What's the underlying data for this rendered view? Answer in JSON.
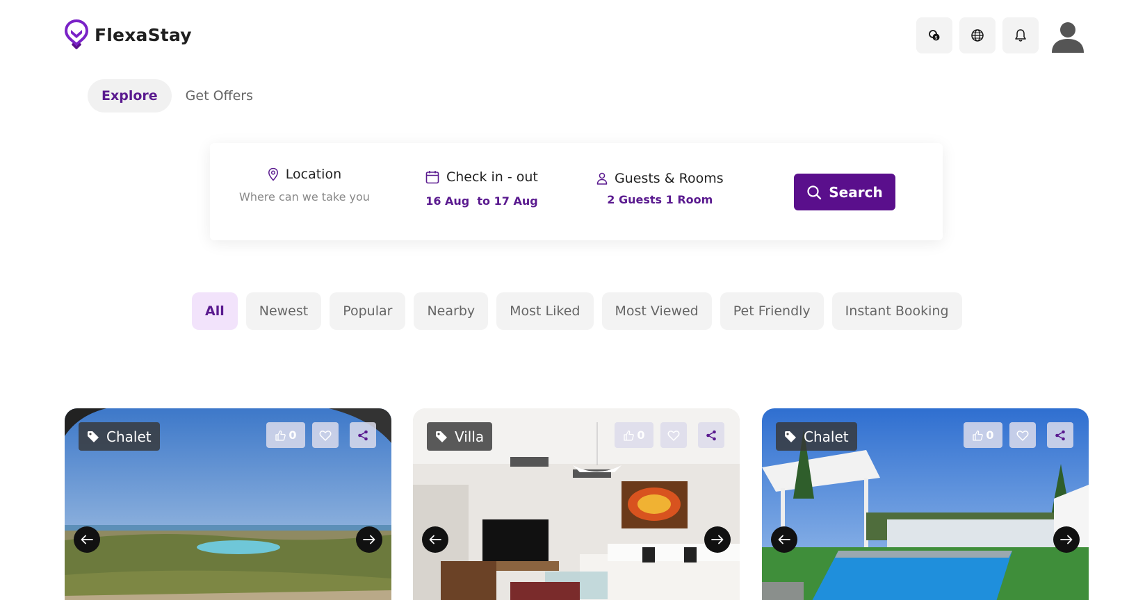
{
  "brand": {
    "name": "FlexaStay",
    "accent": "#5a0f8c"
  },
  "header": {
    "icons": [
      "currency-icon",
      "globe-icon",
      "bell-icon",
      "user-avatar"
    ]
  },
  "tabs": [
    {
      "label": "Explore",
      "active": true
    },
    {
      "label": "Get Offers",
      "active": false
    }
  ],
  "search": {
    "location": {
      "label": "Location",
      "placeholder": "Where can we take you"
    },
    "dates": {
      "label": "Check in - out",
      "value": "16 Aug  to 17 Aug"
    },
    "guests": {
      "label": "Guests & Rooms",
      "value": "2 Guests 1 Room"
    },
    "button_label": "Search"
  },
  "filters": [
    {
      "label": "All",
      "active": true
    },
    {
      "label": "Newest"
    },
    {
      "label": "Popular"
    },
    {
      "label": "Nearby"
    },
    {
      "label": "Most Liked"
    },
    {
      "label": "Most Viewed"
    },
    {
      "label": "Pet Friendly"
    },
    {
      "label": "Instant Booking"
    }
  ],
  "listings": [
    {
      "type": "Chalet",
      "likes": "0"
    },
    {
      "type": "Villa",
      "likes": "0"
    },
    {
      "type": "Chalet",
      "likes": "0"
    }
  ]
}
